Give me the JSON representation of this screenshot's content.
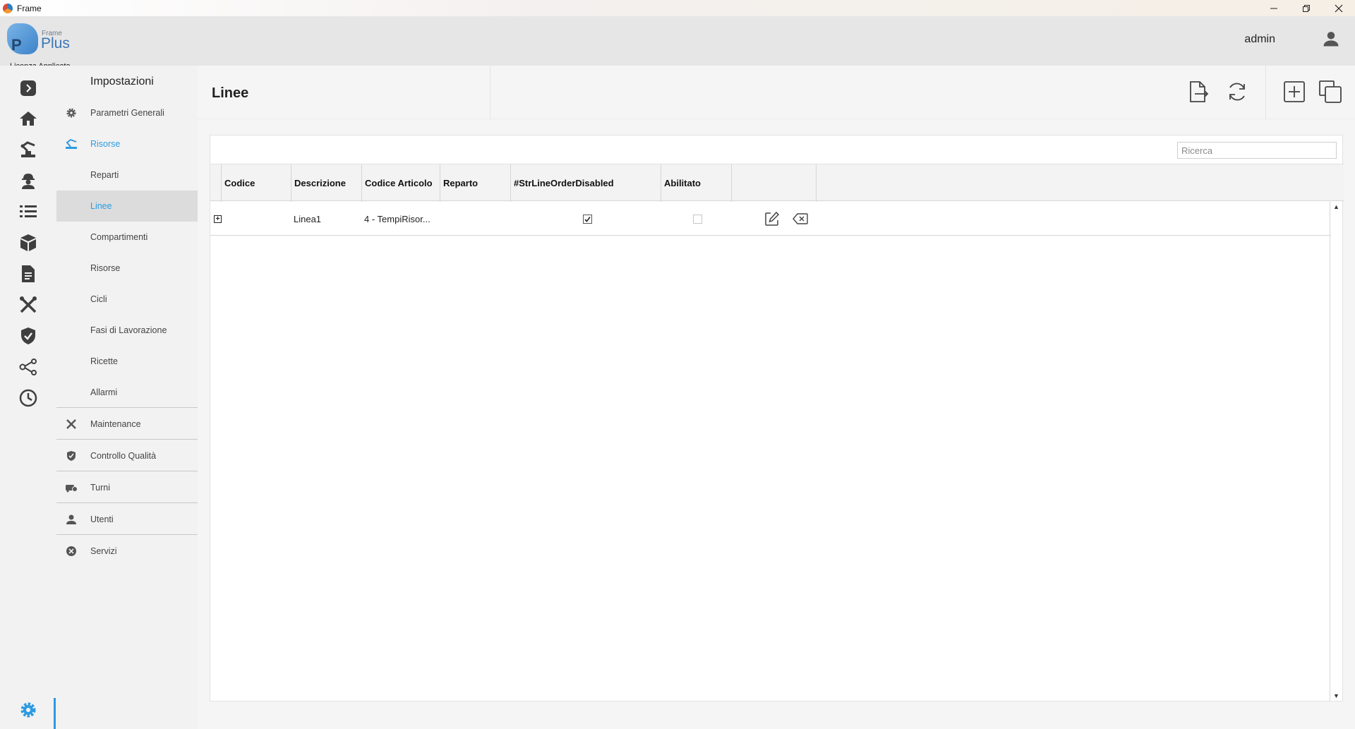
{
  "window": {
    "title": "Frame"
  },
  "header": {
    "logo_small": "Frame",
    "logo_big": "Plus",
    "logo_letter": "P",
    "license": "Licenza Applicata",
    "user": "admin"
  },
  "accent_color": "#2d9be0",
  "settings_menu": {
    "title": "Impostazioni",
    "items": [
      {
        "label": "Parametri Generali",
        "icon": "gear-icon"
      },
      {
        "label": "Risorse",
        "icon": "resources-icon",
        "active": true
      },
      {
        "label": "Reparti"
      },
      {
        "label": "Linee",
        "selected": true
      },
      {
        "label": "Compartimenti"
      },
      {
        "label": "Risorse"
      },
      {
        "label": "Cicli"
      },
      {
        "label": "Fasi di Lavorazione"
      },
      {
        "label": "Ricette"
      },
      {
        "label": "Allarmi"
      },
      {
        "label": "Maintenance",
        "icon": "tools-icon"
      },
      {
        "label": "Controllo Qualità",
        "icon": "shield-check-icon"
      },
      {
        "label": "Turni",
        "icon": "shift-icon"
      },
      {
        "label": "Utenti",
        "icon": "user-icon"
      },
      {
        "label": "Servizi",
        "icon": "services-icon"
      }
    ]
  },
  "page": {
    "title": "Linee"
  },
  "search": {
    "placeholder": "Ricerca"
  },
  "table": {
    "columns": [
      "Codice",
      "Descrizione",
      "Codice Articolo",
      "Reparto",
      "#StrLineOrderDisabled",
      "Abilitato"
    ],
    "rows": [
      {
        "expander": "+",
        "codice": "",
        "descrizione": "Linea1",
        "codice_articolo": "4 - TempiRisor...",
        "reparto": "",
        "str_line_order_disabled": true,
        "abilitato": false
      }
    ]
  }
}
